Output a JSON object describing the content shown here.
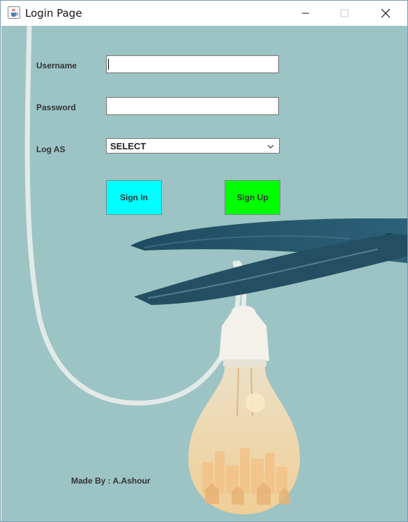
{
  "window": {
    "title": "Login Page"
  },
  "form": {
    "username_label": "Username",
    "username_value": "",
    "password_label": "Password",
    "password_value": "",
    "logas_label": "Log AS",
    "logas_selected": "SELECT"
  },
  "buttons": {
    "signin_label": "Sign In",
    "signup_label": "Sign Up"
  },
  "footer": {
    "credit": "Made By : A.Ashour"
  },
  "colors": {
    "background": "#9cc4c4",
    "signin": "#00ffff",
    "signup": "#00ff00"
  },
  "icons": {
    "app": "java-coffee-icon",
    "minimize": "minimize-icon",
    "maximize": "maximize-icon",
    "close": "close-icon",
    "dropdown": "chevron-down-icon"
  }
}
